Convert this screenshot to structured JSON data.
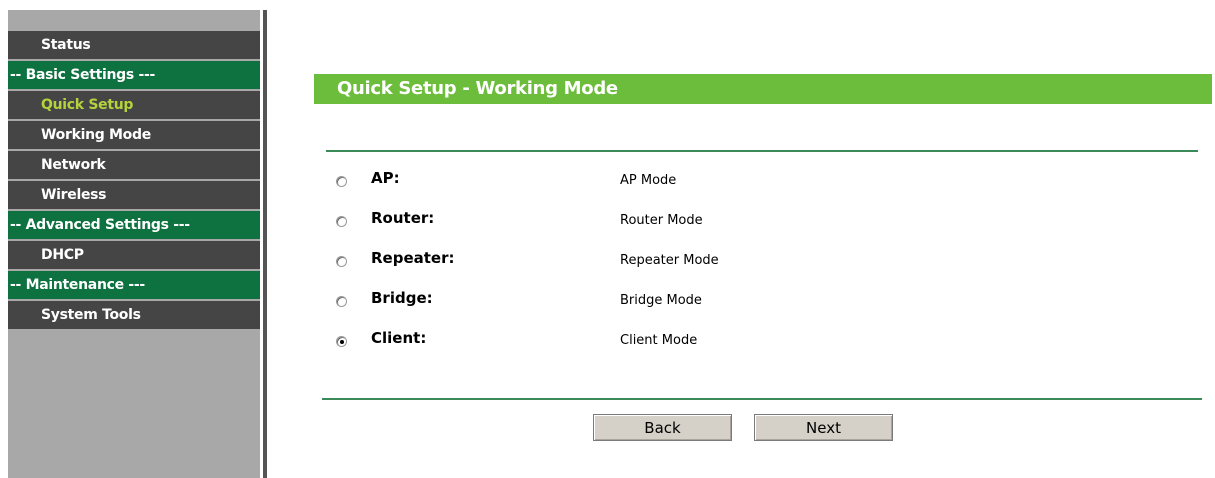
{
  "sidebar": {
    "items": [
      {
        "type": "item",
        "label": "Status",
        "active": false
      },
      {
        "type": "section",
        "label": "-- Basic Settings ---"
      },
      {
        "type": "item",
        "label": "Quick Setup",
        "active": true
      },
      {
        "type": "item",
        "label": "Working Mode",
        "active": false
      },
      {
        "type": "item",
        "label": "Network",
        "active": false
      },
      {
        "type": "item",
        "label": "Wireless",
        "active": false
      },
      {
        "type": "section",
        "label": "-- Advanced Settings ---"
      },
      {
        "type": "item",
        "label": "DHCP",
        "active": false
      },
      {
        "type": "section",
        "label": "-- Maintenance ---"
      },
      {
        "type": "item",
        "label": "System Tools",
        "active": false
      }
    ]
  },
  "main": {
    "title": "Quick Setup - Working Mode",
    "modes": [
      {
        "label": "AP:",
        "description": "AP Mode",
        "selected": false
      },
      {
        "label": "Router:",
        "description": "Router Mode",
        "selected": false
      },
      {
        "label": "Repeater:",
        "description": "Repeater Mode",
        "selected": false
      },
      {
        "label": "Bridge:",
        "description": "Bridge Mode",
        "selected": false
      },
      {
        "label": "Client:",
        "description": "Client Mode",
        "selected": true
      }
    ],
    "buttons": {
      "back": "Back",
      "next": "Next"
    }
  },
  "colors": {
    "title_bar": "#6dbd3c",
    "section_bg": "#0d7140",
    "item_bg": "#454545",
    "active_text": "#b4d23c"
  }
}
